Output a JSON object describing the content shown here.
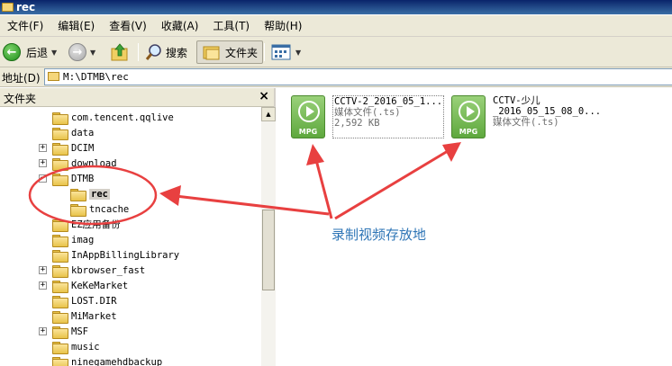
{
  "window": {
    "title": "rec"
  },
  "menu": {
    "items": [
      "文件(F)",
      "编辑(E)",
      "查看(V)",
      "收藏(A)",
      "工具(T)",
      "帮助(H)"
    ]
  },
  "toolbar": {
    "back_label": "后退",
    "search_label": "搜索",
    "folders_label": "文件夹"
  },
  "address": {
    "label": "地址(D)",
    "value": "M:\\DTMB\\rec"
  },
  "panel": {
    "title": "文件夹",
    "close": "×"
  },
  "tree": {
    "items": [
      {
        "label": "com.tencent.qqlive",
        "expander": ""
      },
      {
        "label": "data",
        "expander": ""
      },
      {
        "label": "DCIM",
        "expander": "+"
      },
      {
        "label": "download",
        "expander": "+"
      },
      {
        "label": "DTMB",
        "expander": "−"
      },
      {
        "label": "rec",
        "expander": ""
      },
      {
        "label": "tncache",
        "expander": ""
      },
      {
        "label": "EZ应用备份",
        "expander": ""
      },
      {
        "label": "imag",
        "expander": ""
      },
      {
        "label": "InAppBillingLibrary",
        "expander": ""
      },
      {
        "label": "kbrowser_fast",
        "expander": "+"
      },
      {
        "label": "KeKeMarket",
        "expander": "+"
      },
      {
        "label": "LOST.DIR",
        "expander": ""
      },
      {
        "label": "MiMarket",
        "expander": ""
      },
      {
        "label": "MSF",
        "expander": "+"
      },
      {
        "label": "music",
        "expander": ""
      },
      {
        "label": "ninegamehdbackup",
        "expander": ""
      }
    ]
  },
  "files": [
    {
      "name": "CCTV-2_2016_05_1...",
      "type": "媒体文件(.ts)",
      "size": "2,592 KB",
      "icon_label": "MPG"
    },
    {
      "name": "CCTV-少儿",
      "name2": "_2016_05_15_08_0...",
      "type": "媒体文件(.ts)",
      "icon_label": "MPG"
    }
  ],
  "annotation": {
    "text": "录制视频存放地",
    "color": "#e84040"
  }
}
